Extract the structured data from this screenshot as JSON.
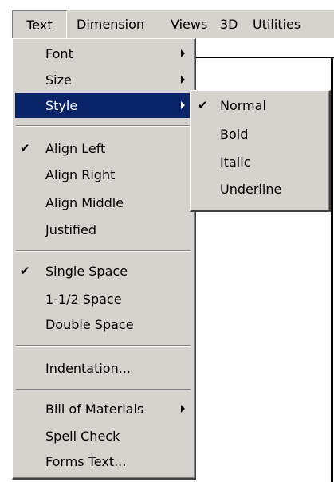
{
  "menubar": {
    "items": [
      "Text",
      "Dimension",
      "Views",
      "3D",
      "Utilities"
    ]
  },
  "text_menu": {
    "font": "Font",
    "size": "Size",
    "style": "Style",
    "align_left": "Align Left",
    "align_right": "Align Right",
    "align_middle": "Align Middle",
    "justified": "Justified",
    "single_space": "Single Space",
    "one_half_space": "1-1/2 Space",
    "double_space": "Double Space",
    "indentation": "Indentation...",
    "bill_of_materials": "Bill of Materials",
    "spell_check": "Spell Check",
    "forms_text": "Forms Text..."
  },
  "style_submenu": {
    "normal": "Normal",
    "bold": "Bold",
    "italic": "Italic",
    "underline": "Underline"
  },
  "checkmark": "✔",
  "colors": {
    "menu_bg": "#d6d3ce",
    "highlight": "#0a246a",
    "highlight_text": "#ffffff"
  },
  "icons": {
    "checked": "check-icon",
    "submenu": "submenu-arrow-icon"
  }
}
